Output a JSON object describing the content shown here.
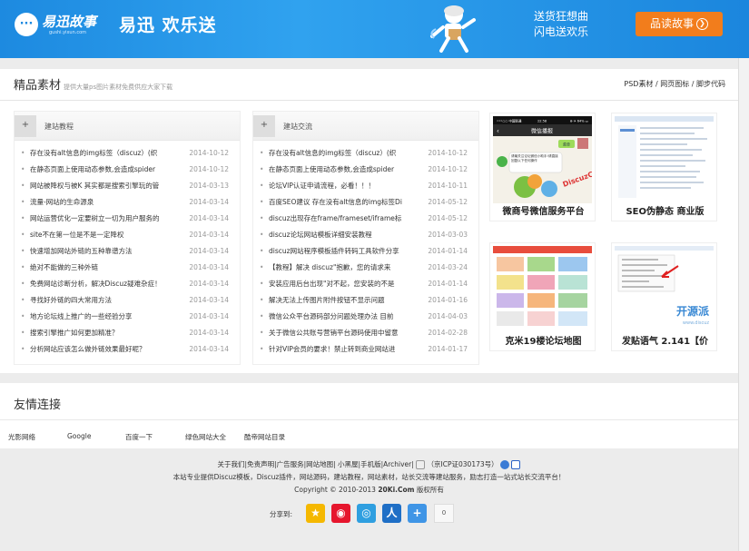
{
  "banner": {
    "logo_mark": "···",
    "logo_text": "易迅故事",
    "logo_sub": "gushi.yixun.com",
    "slogan": "易迅 欢乐送",
    "promo_line1": "送货狂想曲",
    "promo_line2": "闪电送欢乐",
    "cta_label": "品读故事",
    "cta_arrow": "❯"
  },
  "section": {
    "title": "精品素材",
    "subtitle": "提供大量ps图片素材免费供应大家下载",
    "links": "PSD素材 / 网页图标 / 脚步代码"
  },
  "lists": [
    {
      "plus": "+",
      "title": "建站教程",
      "items": [
        {
          "title": "存在没有alt信息的img标签（discuz）(织",
          "date": "2014-10-12"
        },
        {
          "title": "在静态页面上使用动态参数,会造成spider",
          "date": "2014-10-12"
        },
        {
          "title": "网站被降权与被K 其实都是搜索引擎玩的管",
          "date": "2014-03-13"
        },
        {
          "title": "流量-网站的生命源泉",
          "date": "2014-03-14"
        },
        {
          "title": "网站运营优化一定要树立一切为用户服务的",
          "date": "2014-03-14"
        },
        {
          "title": "site不在第一位是不是一定降权",
          "date": "2014-03-14"
        },
        {
          "title": "快速增加网站外链的五种靠谱方法",
          "date": "2014-03-14"
        },
        {
          "title": "绝对不能做的三种外链",
          "date": "2014-03-14"
        },
        {
          "title": "免费网站诊断分析，解决Discuz疑难杂症！",
          "date": "2014-03-14"
        },
        {
          "title": "寻找好外链的四大常用方法",
          "date": "2014-03-14"
        },
        {
          "title": "地方论坛线上推广的一些经验分享",
          "date": "2014-03-14"
        },
        {
          "title": "搜索引擎推广如何更加精准？",
          "date": "2014-03-14"
        },
        {
          "title": "分析网站应该怎么做外链效果最好呢？",
          "date": "2014-03-14"
        }
      ]
    },
    {
      "plus": "+",
      "title": "建站交流",
      "items": [
        {
          "title": "存在没有alt信息的img标签（discuz）(织",
          "date": "2014-10-12"
        },
        {
          "title": "在静态页面上使用动态参数,会造成spider",
          "date": "2014-10-12"
        },
        {
          "title": "论坛VIP认证申请流程，必看！！！",
          "date": "2014-10-11"
        },
        {
          "title": "百度SEO建议 存在没有alt信息的img标签Di",
          "date": "2014-05-12"
        },
        {
          "title": "discuz出现存在frame/frameset/iframe标",
          "date": "2014-05-12"
        },
        {
          "title": "discuz论坛网站模板详细安装教程",
          "date": "2014-03-03"
        },
        {
          "title": "discuz网站程序模板插件转码工具软件分享",
          "date": "2014-01-14"
        },
        {
          "title": "【教程】解决 discuz\"抱歉，您的请求来",
          "date": "2014-03-24"
        },
        {
          "title": "安装应用后台出现\"对不起，您安装的不是",
          "date": "2014-01-14"
        },
        {
          "title": "解决无法上传图片附件按钮不显示问题",
          "date": "2014-01-16"
        },
        {
          "title": "微信公众平台源码部分问题处理办法 目前",
          "date": "2014-04-03"
        },
        {
          "title": "关于微信公共账号营销平台源码使用中留意",
          "date": "2014-02-28"
        },
        {
          "title": "针对VIP会员的要求！禁止转到商业网站进",
          "date": "2014-01-17"
        }
      ]
    }
  ],
  "thumbs": [
    {
      "caption": "微商号微信服务平台",
      "screen": {
        "status_left": "•••○○ 中国联通",
        "status_time": "22:58",
        "status_right": "⊕ ✈ 64% ▭",
        "back": "‹",
        "title": "微信播报",
        "menu_label": "菜单",
        "bubble_text": "请最关注论坛微信小助手!请直接回复以下任何操作",
        "watermark": "DiscuzCN.com"
      }
    },
    {
      "caption": "SEO伪静态 商业版"
    },
    {
      "caption": "克米19楼论坛地图"
    },
    {
      "caption": "发贴语气 2.141【价",
      "watermark": "开源派",
      "watermark_sub": "www.discuz"
    }
  ],
  "friends": {
    "title": "友情连接",
    "links": [
      "光影网络",
      "Google",
      "百度一下",
      "绿色网站大全",
      "酷帝网站目录"
    ]
  },
  "footer": {
    "line1": "关于我们|免责声明|广告服务|网站地图| 小黑屋|手机版|Archiver|",
    "line1_icp": "（京ICP证030173号）",
    "line2": "本站专业提供Discuz模板，Discuz插件，网站源码，建站教程，网站素材，站长交流等建站服务，励志打造一站式站长交流平台！",
    "line3_prefix": "Copyright © 2010-2013 ",
    "line3_brand": "20Ki.Com",
    "line3_suffix": " 版权所有",
    "share_label": "分享到:",
    "share_count": "0",
    "share_icons": [
      "qzone-icon",
      "weibo-icon",
      "tencent-weibo-icon",
      "renren-icon",
      "more-share-icon"
    ]
  }
}
